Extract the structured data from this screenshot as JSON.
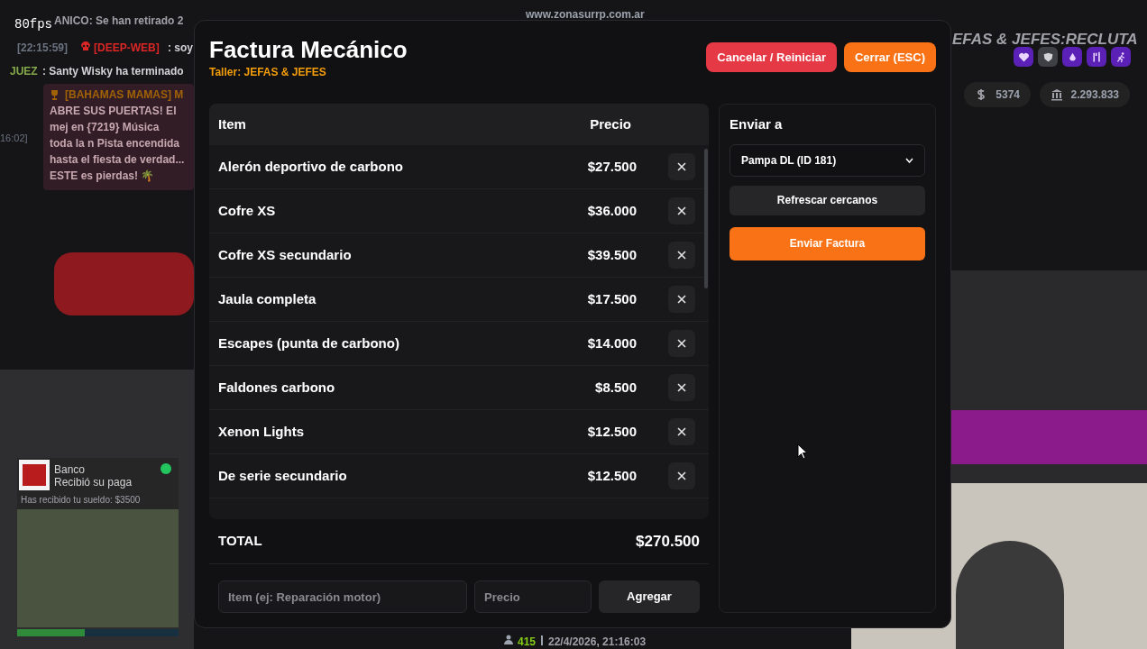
{
  "overlay": {
    "fps": "80fps",
    "site": "www.zonasurrp.com.ar",
    "chat": [
      {
        "kind": "system",
        "text": "ANICO: Se han retirado 2"
      },
      {
        "kind": "deep",
        "time": "[22:15:59]",
        "tag": "[DEEP-WEB]",
        "text": ": soy"
      },
      {
        "kind": "judge",
        "tag": "JUEZ",
        "text": ": Santy Wisky ha terminado"
      },
      {
        "kind": "ad",
        "time": "16:02]",
        "tag": "[BAHAMAS MAMAS] M",
        "text": "ABRE SUS PUERTAS! El mej en {7219} Música toda la n Pista encendida hasta el fiesta de verdad... ESTE es pierdas! 🌴"
      }
    ],
    "job": "EFAS & JEFES:RECLUTA",
    "status_icons": [
      {
        "kind": "heart",
        "color": "#5b21b6"
      },
      {
        "kind": "shield",
        "color": "#3f3f46"
      },
      {
        "kind": "drop",
        "color": "#5b21b6"
      },
      {
        "kind": "food",
        "color": "#5b21b6"
      },
      {
        "kind": "run",
        "color": "#5b21b6"
      }
    ],
    "money": [
      {
        "kind": "cash",
        "value": "5374"
      },
      {
        "kind": "bank",
        "value": "2.293.833"
      }
    ],
    "notification": {
      "title": "Banco",
      "subtitle": "Recibió su paga",
      "body": "Has recibido tu sueldo: $3500"
    },
    "health": {
      "level": 0.42
    },
    "footer": {
      "players": "415",
      "datetime": "22/4/2026, 21:16:03"
    }
  },
  "window": {
    "title": "Factura Mecánico",
    "subtitle": "Taller: JEFAS & JEFES",
    "buttons": [
      {
        "kind": "danger",
        "label": "Cancelar / Reiniciar"
      },
      {
        "kind": "primary",
        "label": "Cerrar (ESC)"
      }
    ]
  },
  "table": {
    "columns": [
      "Item",
      "Precio"
    ],
    "rows": [
      {
        "item": "Alerón deportivo de carbono",
        "price": "$27.500"
      },
      {
        "item": "Cofre XS",
        "price": "$36.000"
      },
      {
        "item": "Cofre XS secundario",
        "price": "$39.500"
      },
      {
        "item": "Jaula completa",
        "price": "$17.500"
      },
      {
        "item": "Escapes (punta de carbono)",
        "price": "$14.000"
      },
      {
        "item": "Faldones carbono",
        "price": "$8.500"
      },
      {
        "item": "Xenon Lights",
        "price": "$12.500"
      },
      {
        "item": "De serie secundario",
        "price": "$12.500"
      }
    ],
    "total_label": "TOTAL",
    "total": "$270.500"
  },
  "add_form": {
    "item_placeholder": "Item (ej: Reparación motor)",
    "price_placeholder": "Precio",
    "button": "Agregar"
  },
  "send": {
    "heading": "Enviar a",
    "recipient": "Pampa DL (ID 181)",
    "refresh": "Refrescar cercanos",
    "submit": "Enviar Factura"
  }
}
